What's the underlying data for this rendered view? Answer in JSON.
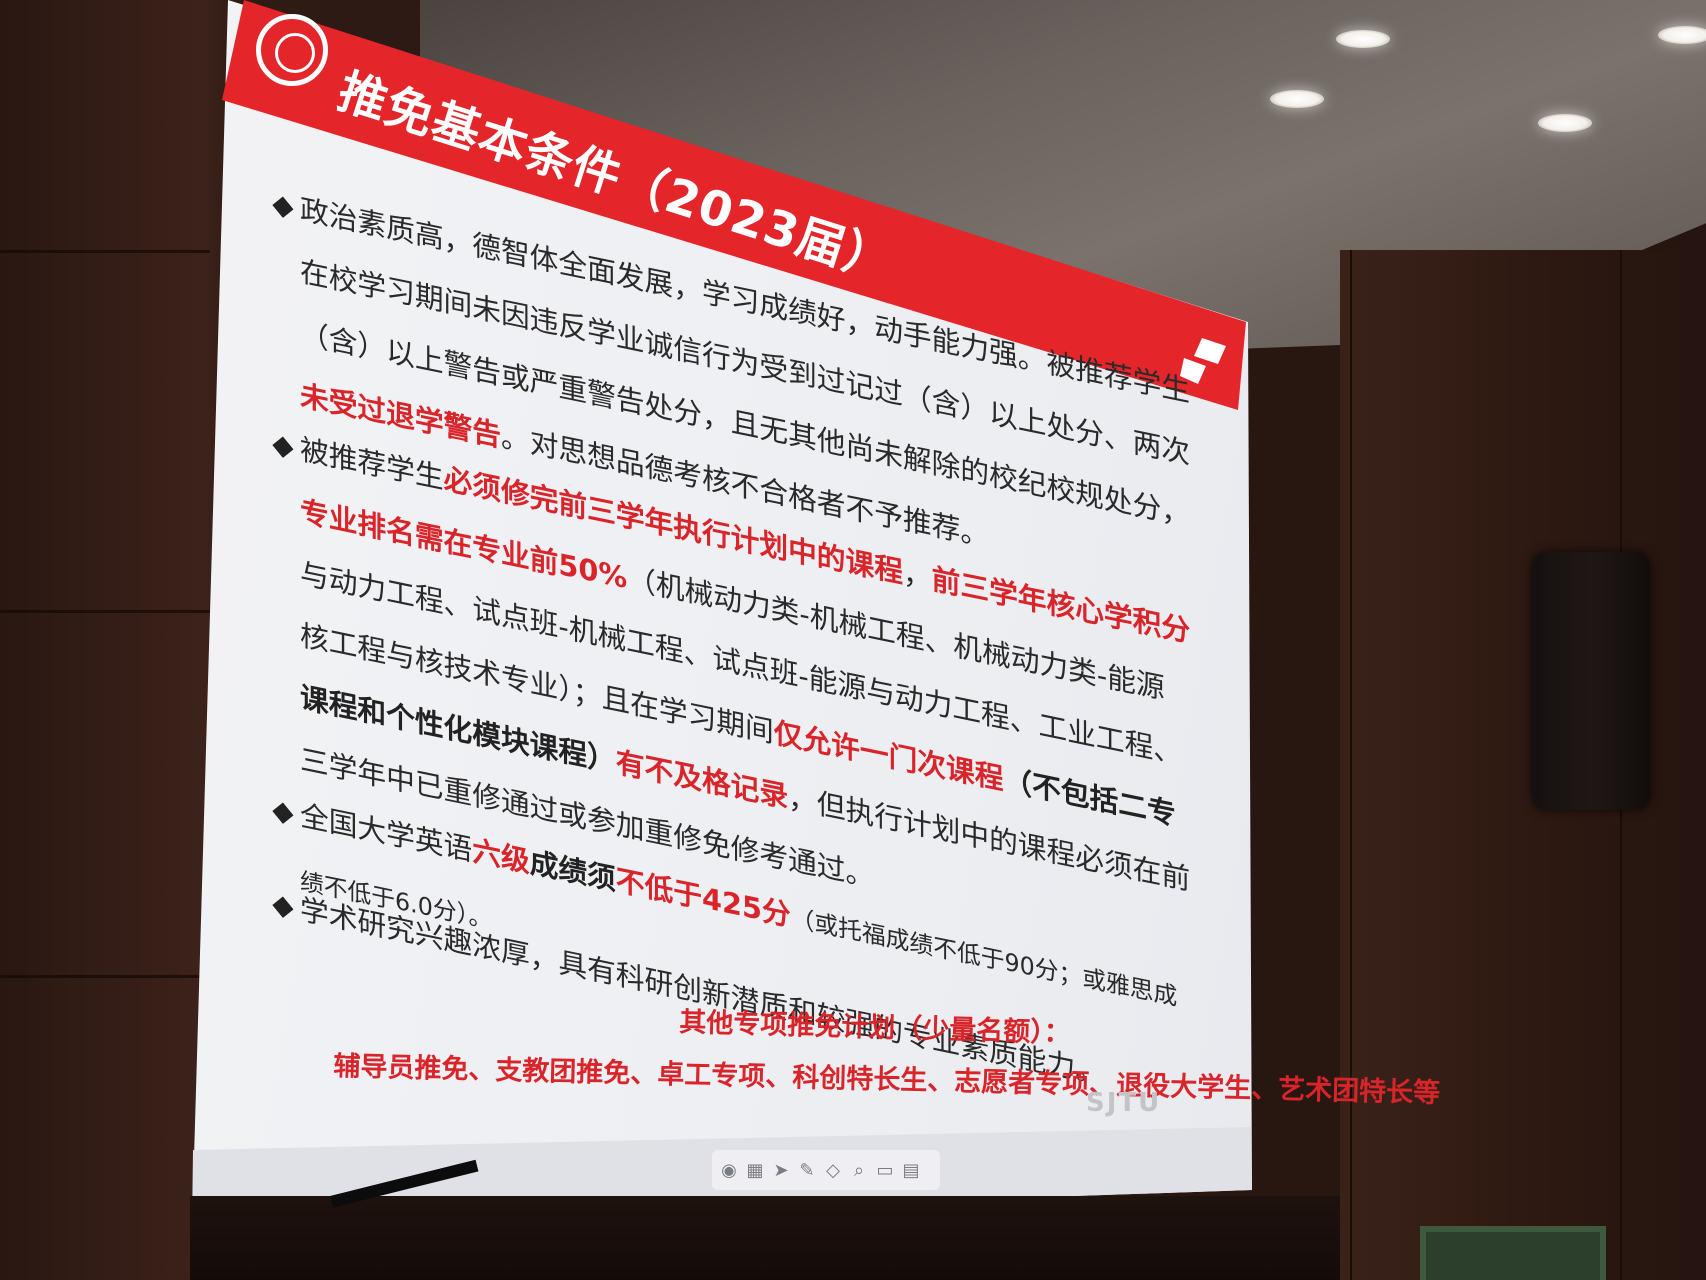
{
  "slide": {
    "title": "推免基本条件（2023届）",
    "bullets": [
      {
        "segments": [
          {
            "text": "政治素质高，德智体全面发展，学习成绩好，动手能力强。被推荐学生在校学习期间未因违反学业诚信行为受到过记过（含）以上处分、两次（含）以上警告或严重警告处分，且无其他尚未解除的校纪校规处分，",
            "style": "normal"
          },
          {
            "text": "未受过退学警告",
            "style": "red"
          },
          {
            "text": "。对思想品德考核不合格者不予推荐。",
            "style": "normal"
          }
        ]
      },
      {
        "segments": [
          {
            "text": "被推荐学生",
            "style": "normal"
          },
          {
            "text": "必须修完前三学年执行计划中的课程",
            "style": "red"
          },
          {
            "text": "，",
            "style": "normal"
          },
          {
            "text": "前三学年核心学积分专业排名需在专业前50%",
            "style": "red"
          },
          {
            "text": "（机械动力类-机械工程、机械动力类-能源与动力工程、试点班-机械工程、试点班-能源与动力工程、工业工程、核工程与核技术专业）；且在学习期间",
            "style": "normal"
          },
          {
            "text": "仅允许一门次课程",
            "style": "red"
          },
          {
            "text": "（不包括二专课程和个性化模块课程）",
            "style": "bold"
          },
          {
            "text": "有不及格记录",
            "style": "red"
          },
          {
            "text": "，但执行计划中的课程必须在前三学年中已重修通过或参加重修免修考通过。",
            "style": "normal"
          }
        ]
      },
      {
        "segments": [
          {
            "text": "全国大学英语",
            "style": "normal"
          },
          {
            "text": "六级",
            "style": "red"
          },
          {
            "text": "成绩须",
            "style": "bold"
          },
          {
            "text": "不低于425分",
            "style": "red"
          },
          {
            "text": "（或托福成绩不低于90分；或雅思成绩不低于6.0分）。",
            "style": "small"
          }
        ]
      },
      {
        "segments": [
          {
            "text": "学术研究兴趣浓厚，具有科研创新潜质和较强的专业素质能力。",
            "style": "normal"
          }
        ]
      }
    ],
    "special_heading": "其他专项推免计划（少量名额）：",
    "special_list": "辅导员推免、支教团推免、卓工专项、科创特长生、志愿者专项、退役大学生、艺术团特长等",
    "watermark": "SJTU",
    "colors": {
      "banner": "#e4262b",
      "highlight": "#d9252a",
      "slide_bg": "#eceef2"
    },
    "toolbar_icons": [
      "share-icon",
      "grid-icon",
      "pointer-icon",
      "pen-icon",
      "eraser-icon",
      "zoom-icon",
      "screen-icon",
      "note-icon"
    ]
  }
}
